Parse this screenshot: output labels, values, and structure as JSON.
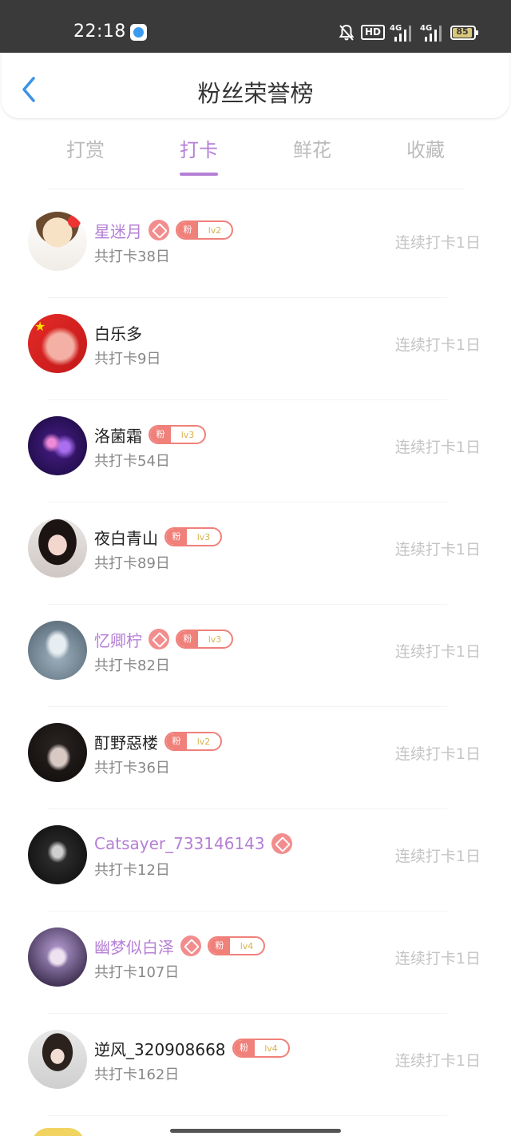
{
  "status_bar": {
    "time": "22:18",
    "hd_label": "HD",
    "signal1": "4G",
    "signal2": "4G",
    "battery": "85"
  },
  "header": {
    "title": "粉丝荣誉榜",
    "back_icon": "chevron-left-icon"
  },
  "tabs": [
    {
      "label": "打赏",
      "active": false
    },
    {
      "label": "打卡",
      "active": true
    },
    {
      "label": "鲜花",
      "active": false
    },
    {
      "label": "收藏",
      "active": false
    }
  ],
  "list": [
    {
      "name": "星迷月",
      "vip": true,
      "fan_label": "粉",
      "level": "lv2",
      "count": "共打卡38日",
      "streak": "连续打卡1日"
    },
    {
      "name": "白乐多",
      "vip": false,
      "fan_label": "",
      "level": "",
      "count": "共打卡9日",
      "streak": "连续打卡1日"
    },
    {
      "name": "洛菌霜",
      "vip": false,
      "fan_label": "粉",
      "level": "lv3",
      "count": "共打卡54日",
      "streak": "连续打卡1日"
    },
    {
      "name": "夜白青山",
      "vip": false,
      "fan_label": "粉",
      "level": "lv3",
      "count": "共打卡89日",
      "streak": "连续打卡1日"
    },
    {
      "name": "忆卿柠",
      "vip": true,
      "fan_label": "粉",
      "level": "lv3",
      "count": "共打卡82日",
      "streak": "连续打卡1日"
    },
    {
      "name": "酊野惡楼",
      "vip": false,
      "fan_label": "粉",
      "level": "lv2",
      "count": "共打卡36日",
      "streak": "连续打卡1日"
    },
    {
      "name": "Catsayer_733146143",
      "vip": true,
      "fan_label": "",
      "level": "",
      "count": "共打卡12日",
      "streak": "连续打卡1日"
    },
    {
      "name": "幽梦似白泽",
      "vip": true,
      "fan_label": "粉",
      "level": "lv4",
      "count": "共打卡107日",
      "streak": "连续打卡1日"
    },
    {
      "name": "逆风_320908668",
      "vip": false,
      "fan_label": "粉",
      "level": "lv4",
      "count": "共打卡162日",
      "streak": "连续打卡1日"
    }
  ],
  "colors": {
    "accent": "#b57fd6",
    "fan_badge": "#f0807a",
    "level_text": "#d7b24a",
    "muted": "#c4c4c4"
  }
}
